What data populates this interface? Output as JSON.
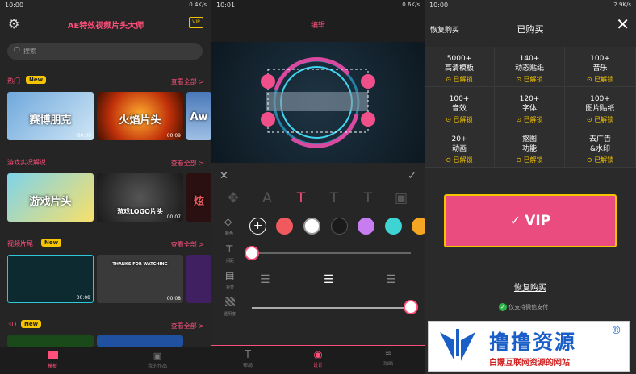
{
  "p1": {
    "status_time": "10:00",
    "status_right": "0.4K/s",
    "title": "AE特效视频片头大师",
    "search_placeholder": "搜索",
    "sections": [
      {
        "title": "热门",
        "badge": "New",
        "more": "查看全部 >"
      },
      {
        "title": "游戏实况解说",
        "badge": "",
        "more": "查看全部 >"
      },
      {
        "title": "视频片尾",
        "badge": "New",
        "more": "查看全部 >"
      },
      {
        "title": "3D",
        "badge": "New",
        "more": "查看全部 >"
      }
    ],
    "thumbs": [
      {
        "text": "赛博朋克",
        "dur": "00:09"
      },
      {
        "text": "火焰片头",
        "dur": "00:09"
      },
      {
        "text": "Aw",
        "dur": ""
      },
      {
        "text": "游戏片头",
        "dur": ""
      },
      {
        "text": "游戏LOGO片头",
        "dur": "00:07"
      },
      {
        "text": "炫",
        "dur": ""
      },
      {
        "text": "",
        "dur": "00:08"
      },
      {
        "text": "THANKS FOR WATCHING",
        "dur": "00:08"
      }
    ],
    "nav": [
      {
        "label": "模板"
      },
      {
        "label": "我的作品"
      }
    ]
  },
  "p2": {
    "status_time": "10:01",
    "status_right": "0.6K/s",
    "title": "编辑",
    "labels": [
      "颜色",
      "间距",
      "对齐",
      "透明度"
    ],
    "nav": [
      {
        "label": "布局"
      },
      {
        "label": "设计"
      },
      {
        "label": "动画"
      }
    ],
    "colors": [
      "#ffffff",
      "#f05a5e",
      "#ffffff",
      "#1a1a1a",
      "#c77cf0",
      "#3fd4d4",
      "#f5a623"
    ]
  },
  "p3": {
    "status_time": "10:00",
    "status_right": "2.9K/s",
    "restore_top": "恢复购买",
    "title": "已购买",
    "cells": [
      {
        "a": "5000+",
        "b": "高清模板"
      },
      {
        "a": "140+",
        "b": "动态贴纸"
      },
      {
        "a": "100+",
        "b": "音乐"
      },
      {
        "a": "100+",
        "b": "音效"
      },
      {
        "a": "120+",
        "b": "字体"
      },
      {
        "a": "100+",
        "b": "图片贴纸"
      },
      {
        "a": "20+",
        "b": "动画"
      },
      {
        "a": "抠图",
        "b": "功能"
      },
      {
        "a": "去广告",
        "b": "&水印"
      }
    ],
    "unlocked": "已解锁",
    "vip": "VIP",
    "restore": "恢复购买",
    "wechat": "仅支持微信支付",
    "logo_main": "撸撸资源",
    "logo_sub": "白嫖互联网资源的网站"
  }
}
